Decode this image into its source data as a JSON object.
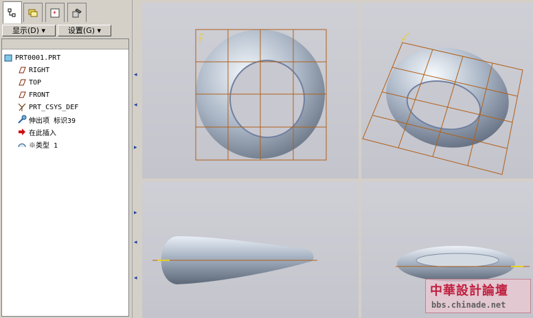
{
  "toolbar": {
    "display_label": "显示(D)",
    "settings_label": "设置(G)"
  },
  "tree": {
    "items": [
      {
        "label": "PRT0001.PRT"
      },
      {
        "label": "RIGHT"
      },
      {
        "label": "TOP"
      },
      {
        "label": "FRONT"
      },
      {
        "label": "PRT_CSYS_DEF"
      },
      {
        "label": "伸出项 标识39"
      },
      {
        "label": "在此插入"
      },
      {
        "label": "※类型 1"
      }
    ]
  },
  "icons": {
    "tab1": "model-tree-icon",
    "tab2": "layers-icon",
    "tab3": "favorites-icon",
    "tab4": "tools-icon"
  },
  "colors": {
    "grid": "#b06018",
    "model": "#9aa8b8",
    "view_bg": "#c8c8d0"
  },
  "watermark": {
    "title": "中華設計論壇",
    "url": "bbs.chinade.net"
  }
}
